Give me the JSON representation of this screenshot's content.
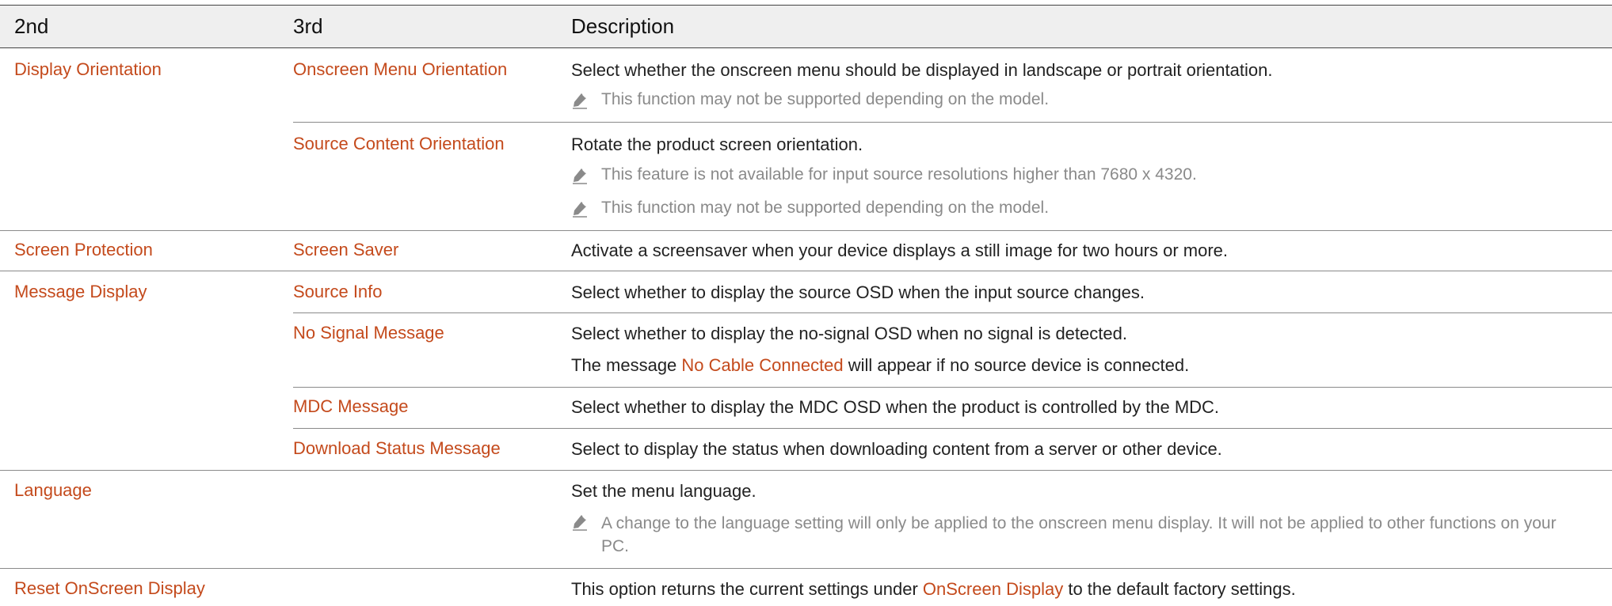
{
  "header": {
    "col2": "2nd",
    "col3": "3rd",
    "col4": "Description"
  },
  "rows": {
    "display_orientation": {
      "second": "Display Orientation",
      "onscreen_menu": {
        "third": "Onscreen Menu Orientation",
        "desc": "Select whether the onscreen menu should be displayed in landscape or portrait orientation.",
        "note1": "This function may not be supported depending on the model."
      },
      "source_content": {
        "third": "Source Content Orientation",
        "desc": "Rotate the product screen orientation.",
        "note1": "This feature is not available for input source resolutions higher than 7680 x 4320.",
        "note2": "This function may not be supported depending on the model."
      }
    },
    "screen_protection": {
      "second": "Screen Protection",
      "third": "Screen Saver",
      "desc": "Activate a screensaver when your device displays a still image for two hours or more."
    },
    "message_display": {
      "second": "Message Display",
      "source_info": {
        "third": "Source Info",
        "desc": "Select whether to display the source OSD when the input source changes."
      },
      "no_signal": {
        "third": "No Signal Message",
        "desc": "Select whether to display the no-signal OSD when no signal is detected.",
        "desc2_pre": "The message ",
        "desc2_hl": "No Cable Connected",
        "desc2_post": " will appear if no source device is connected."
      },
      "mdc": {
        "third": "MDC Message",
        "desc": "Select whether to display the MDC OSD when the product is controlled by the MDC."
      },
      "download": {
        "third": "Download Status Message",
        "desc": "Select to display the status when downloading content from a server or other device."
      }
    },
    "language": {
      "second": "Language",
      "desc": "Set the menu language.",
      "note1": "A change to the language setting will only be applied to the onscreen menu display. It will not be applied to other functions on your PC."
    },
    "reset": {
      "second": "Reset OnScreen Display",
      "desc_pre": "This option returns the current settings under ",
      "desc_hl": "OnScreen Display",
      "desc_post": " to the default factory settings."
    }
  },
  "colors": {
    "accent": "#c44a1c",
    "note": "#8a8a8a",
    "header_bg": "#efefef"
  },
  "icons": {
    "note": "pencil-note-icon"
  }
}
